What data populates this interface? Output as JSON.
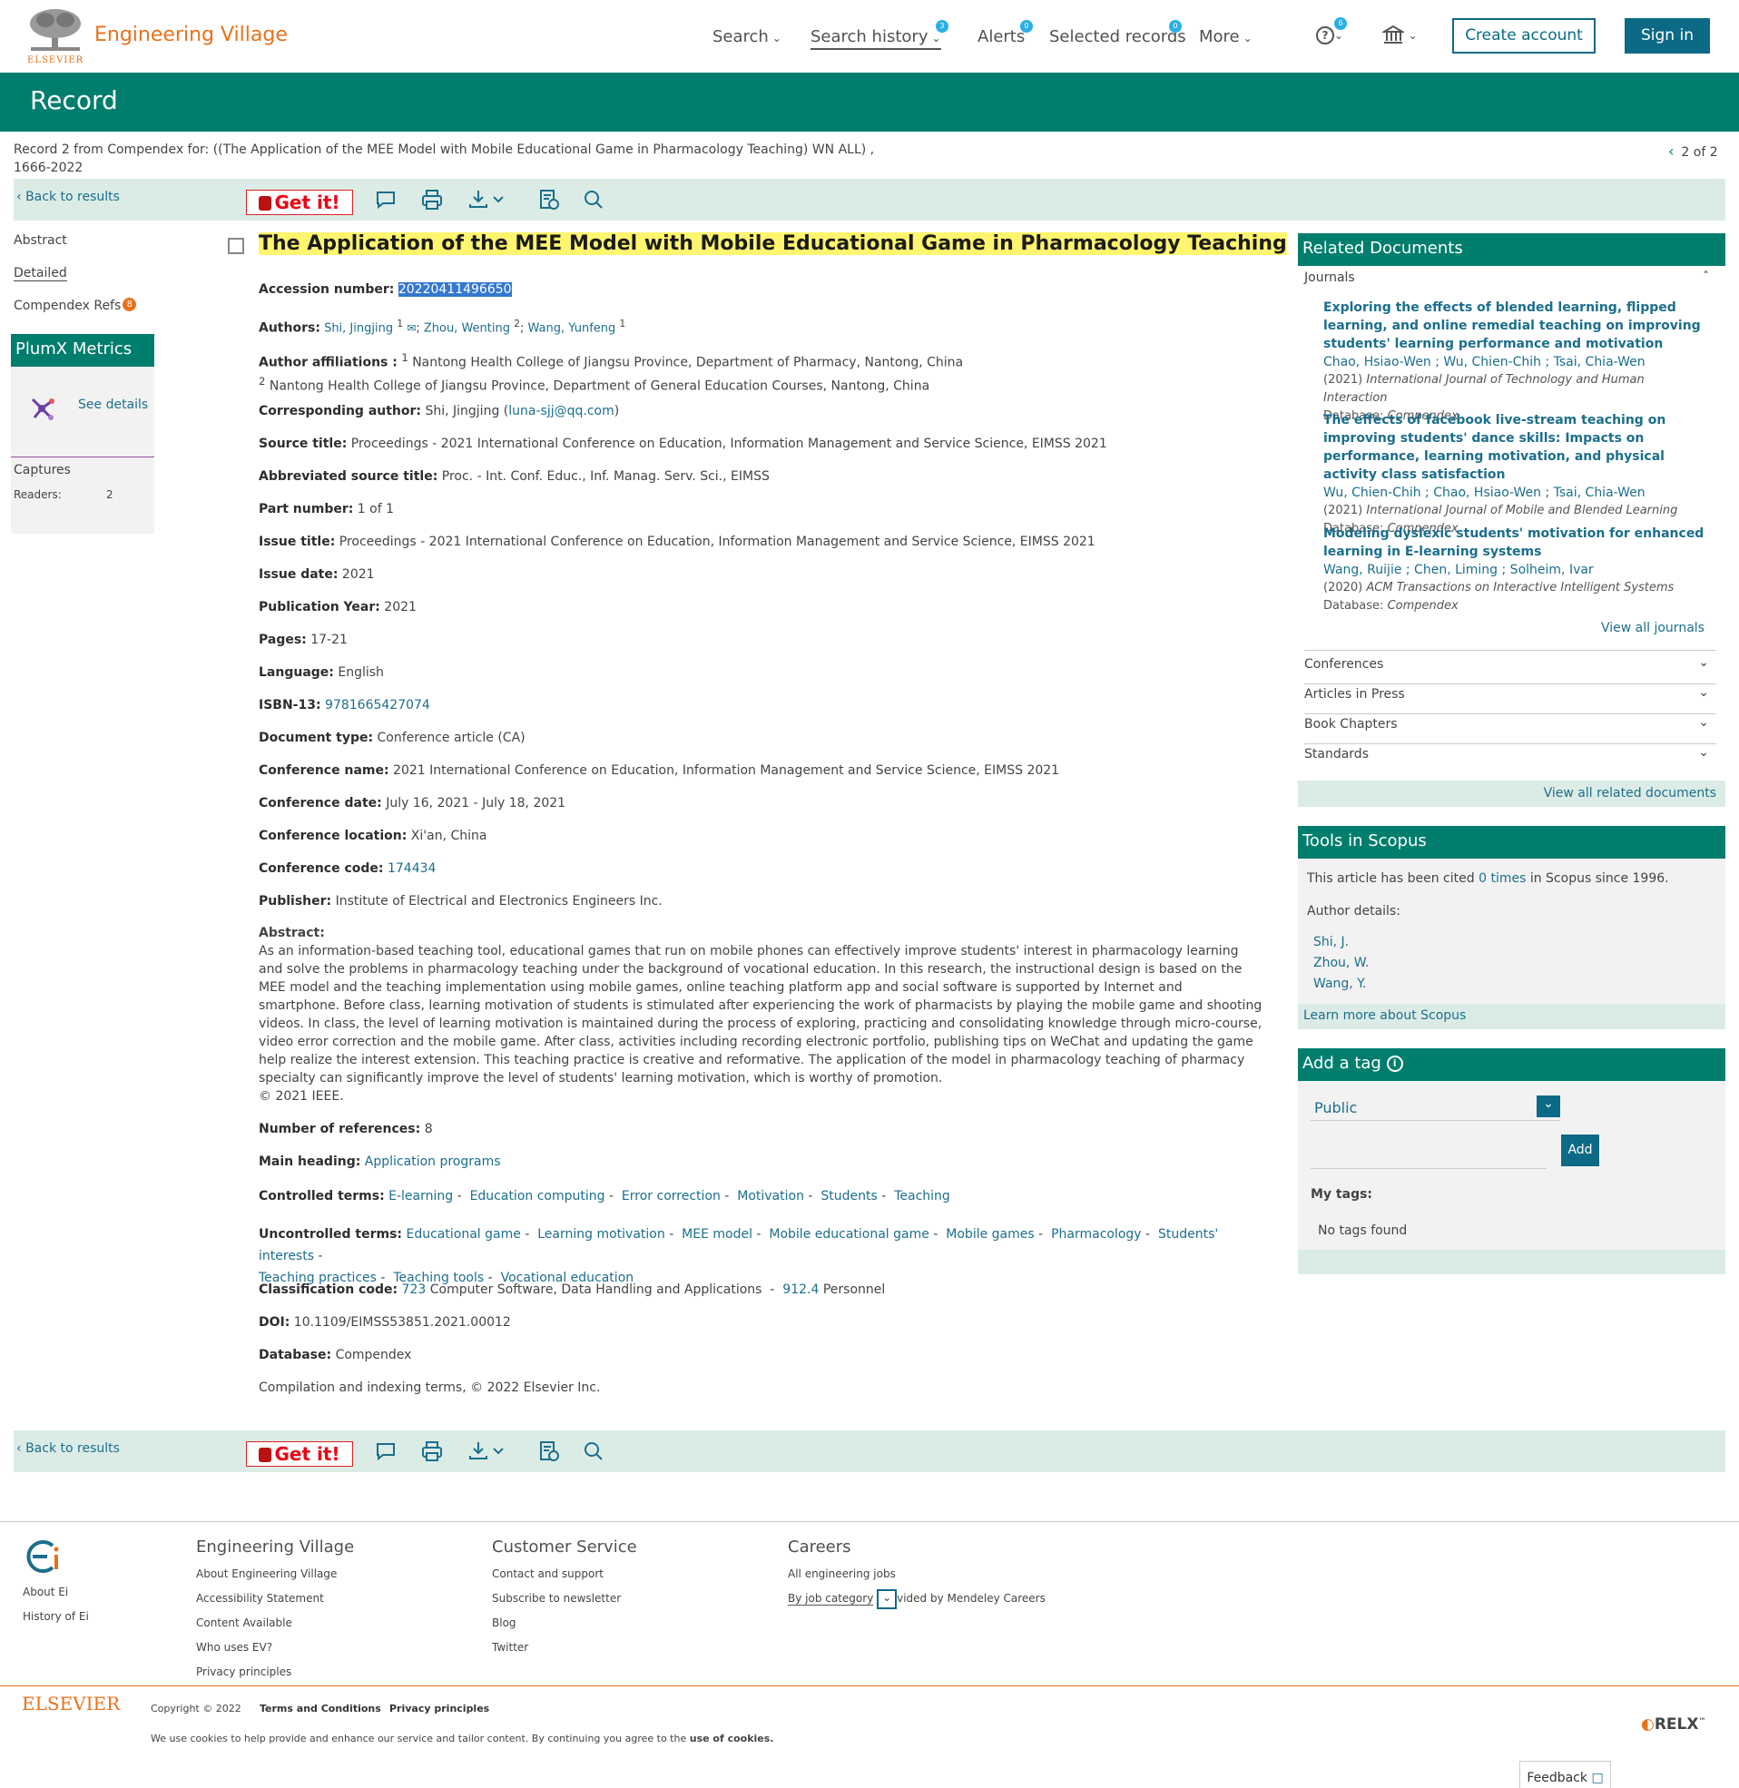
{
  "header": {
    "brand": "Engineering Village",
    "elsevier_small": "ELSEVIER",
    "nav": [
      "Search",
      "Search history",
      "Alerts",
      "Selected records",
      "More"
    ],
    "badges": {
      "search_history": "3",
      "alerts": "0",
      "selected_records": "0",
      "help": "6"
    },
    "create_account": "Create account",
    "sign_in": "Sign in"
  },
  "page_title": "Record",
  "record_info": "Record 2 from Compendex for: ((The Application of the MEE Model with Mobile Educational Game in Pharmacology Teaching) WN ALL) , 1666-2022",
  "pager": "2 of 2",
  "toolbar": {
    "back": "Back to results",
    "getit": "Get it!"
  },
  "left_nav": {
    "abstract": "Abstract",
    "detailed": "Detailed",
    "refs": "Compendex Refs",
    "refs_count": "8",
    "plumx": "PlumX Metrics",
    "see_details": "See details",
    "captures": "Captures",
    "readers_label": "Readers:",
    "readers_value": "2"
  },
  "record": {
    "title": "The Application of the MEE Model with Mobile Educational Game in Pharmacology Teaching",
    "accession_label": "Accession number:",
    "accession": "20220411496650",
    "authors_label": "Authors:",
    "authors": [
      "Shi, Jingjing",
      "Zhou, Wenting",
      "Wang, Yunfeng"
    ],
    "affil_label": "Author affiliations :",
    "affil1": "Nantong Health College of Jiangsu Province, Department of Pharmacy, Nantong, China",
    "affil2": "Nantong Health College of Jiangsu Province, Department of General Education Courses, Nantong, China",
    "corr_label": "Corresponding author:",
    "corr_name": "Shi, Jingjing",
    "corr_email": "luna-sjj@qq.com",
    "source_label": "Source title:",
    "source": "Proceedings - 2021 International Conference on Education, Information Management and Service Science, EIMSS 2021",
    "abbr_label": "Abbreviated source title:",
    "abbr": "Proc. - Int. Conf. Educ., Inf. Manag. Serv. Sci., EIMSS",
    "part_label": "Part number:",
    "part": "1 of 1",
    "issue_title_label": "Issue title:",
    "issue_title": "Proceedings - 2021 International Conference on Education, Information Management and Service Science, EIMSS 2021",
    "issue_date_label": "Issue date:",
    "issue_date": "2021",
    "pubyear_label": "Publication Year:",
    "pubyear": "2021",
    "pages_label": "Pages:",
    "pages": "17-21",
    "lang_label": "Language:",
    "lang": "English",
    "isbn_label": "ISBN-13:",
    "isbn": "9781665427074",
    "doctype_label": "Document type:",
    "doctype": "Conference article (CA)",
    "confname_label": "Conference name:",
    "confname": "2021 International Conference on Education, Information Management and Service Science, EIMSS 2021",
    "confdate_label": "Conference date:",
    "confdate": "July 16, 2021 - July 18, 2021",
    "confloc_label": "Conference location:",
    "confloc": "Xi'an, China",
    "confcode_label": "Conference code:",
    "confcode": "174434",
    "publisher_label": "Publisher:",
    "publisher": "Institute of Electrical and Electronics Engineers Inc.",
    "abstract_label": "Abstract:",
    "abstract": "As an information-based teaching tool, educational games that run on mobile phones can effectively improve students' interest in pharmacology learning and solve the problems in pharmacology teaching under the background of vocational education. In this research, the instructional design is based on the MEE model and the teaching implementation using mobile games, online teaching platform app and social software is supported by Internet and smartphone. Before class, learning motivation of students is stimulated after experiencing the work of pharmacists by playing the mobile game and shooting videos. In class, the level of learning motivation is maintained during the process of exploring, practicing and consolidating knowledge through micro-course, video error correction and the mobile game. After class, activities including recording electronic portfolio, publishing tips on WeChat and updating the game help realize the interest extension. This teaching practice is creative and reformative. The application of the model in pharmacology teaching of pharmacy specialty can significantly improve the level of students' learning motivation, which is worthy of promotion.",
    "copyright_ieee": "© 2021 IEEE.",
    "nrefs_label": "Number of references:",
    "nrefs": "8",
    "mainhead_label": "Main heading:",
    "mainhead": "Application programs",
    "controlled_label": "Controlled terms:",
    "controlled": [
      "E-learning",
      "Education computing",
      "Error correction",
      "Motivation",
      "Students",
      "Teaching"
    ],
    "uncontrolled_label": "Uncontrolled terms:",
    "uncontrolled": [
      "Educational game",
      "Learning motivation",
      "MEE model",
      "Mobile educational game",
      "Mobile games",
      "Pharmacology",
      "Students' interests",
      "Teaching practices",
      "Teaching tools",
      "Vocational education"
    ],
    "class_label": "Classification code:",
    "class1_code": "723",
    "class1_text": "Computer Software, Data Handling and Applications",
    "class2_code": "912.4",
    "class2_text": "Personnel",
    "doi_label": "DOI:",
    "doi": "10.1109/EIMSS53851.2021.00012",
    "db_label": "Database:",
    "db": "Compendex",
    "compilation": "Compilation and indexing terms, © 2022 Elsevier Inc."
  },
  "related": {
    "header": "Related Documents",
    "journals": "Journals",
    "items": [
      {
        "title": "Exploring the effects of blended learning, flipped learning, and online remedial teaching on improving students' learning performance and motivation",
        "authors": "Chao, Hsiao-Wen ; Wu, Chien-Chih ; Tsai, Chia-Wen",
        "year": "(2021)",
        "journal": "International Journal of Technology and Human Interaction",
        "db_label": "Database:",
        "db": "Compendex"
      },
      {
        "title": "The effects of facebook live-stream teaching on improving students' dance skills: Impacts on performance, learning motivation, and physical activity class satisfaction",
        "authors": "Wu, Chien-Chih ; Chao, Hsiao-Wen ; Tsai, Chia-Wen",
        "year": "(2021)",
        "journal": "International Journal of Mobile and Blended Learning",
        "db_label": "Database:",
        "db": "Compendex"
      },
      {
        "title": "Modeling dyslexic students' motivation for enhanced learning in E-learning systems",
        "authors": "Wang, Ruijie ; Chen, Liming ; Solheim, Ivar",
        "year": "(2020)",
        "journal": "ACM Transactions on Interactive Intelligent Systems",
        "db_label": "Database:",
        "db": "Compendex"
      }
    ],
    "view_journals": "View all journals",
    "sections": [
      "Conferences",
      "Articles in Press",
      "Book Chapters",
      "Standards"
    ],
    "view_all": "View all related documents"
  },
  "scopus": {
    "header": "Tools in Scopus",
    "cited_pre": "This article has been cited",
    "cited_times": "0 times",
    "cited_post": "in Scopus since 1996.",
    "author_details": "Author details:",
    "authors": [
      "Shi, J.",
      "Zhou, W.",
      "Wang, Y."
    ],
    "learn_more": "Learn more about Scopus"
  },
  "tag": {
    "header": "Add a tag",
    "visibility": "Public",
    "add": "Add",
    "my_tags": "My tags:",
    "none": "No tags found"
  },
  "footer": {
    "about_ei": "About Ei",
    "history_ei": "History of Ei",
    "ev_head": "Engineering Village",
    "ev_links": [
      "About Engineering Village",
      "Accessibility Statement",
      "Content Available",
      "Who uses EV?",
      "Privacy principles"
    ],
    "cs_head": "Customer Service",
    "cs_links": [
      "Contact and support",
      "Subscribe to newsletter",
      "Blog",
      "Twitter"
    ],
    "careers_head": "Careers",
    "careers_links": [
      "All engineering jobs"
    ],
    "by_job": "By job category",
    "provided": "vided by Mendeley Careers",
    "elsevier": "ELSEVIER",
    "copyright": "Copyright © 2022",
    "terms": "Terms and Conditions",
    "privacy": "Privacy principles",
    "cookies_pre": "We use cookies to help provide and enhance our service and tailor content. By continuing you agree to the",
    "cookies_link": "use of cookies.",
    "relx": "RELX",
    "feedback": "Feedback"
  },
  "colors": {
    "teal": "#007e6d",
    "accent_blue": "#0c6a86",
    "link": "#1c6e8c",
    "orange": "#e9711c",
    "highlight": "#fff56e",
    "toolbar_bg": "#dbece6"
  }
}
